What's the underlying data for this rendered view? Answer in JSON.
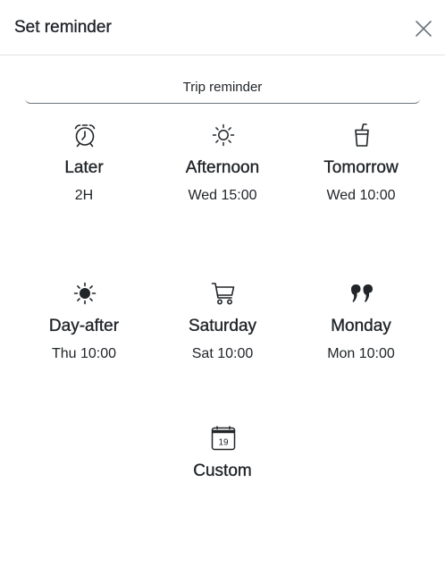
{
  "dialog": {
    "title": "Set reminder",
    "close_icon": "close-icon"
  },
  "input": {
    "value": "Trip reminder",
    "placeholder": ""
  },
  "options": [
    {
      "id": "later",
      "label": "Later",
      "time": "2H",
      "icon": "alarm-clock-icon"
    },
    {
      "id": "afternoon",
      "label": "Afternoon",
      "time": "Wed 15:00",
      "icon": "sun-outline-icon"
    },
    {
      "id": "tomorrow",
      "label": "Tomorrow",
      "time": "Wed 10:00",
      "icon": "cup-straw-icon"
    },
    {
      "id": "day-after",
      "label": "Day-after",
      "time": "Thu 10:00",
      "icon": "sun-fill-icon"
    },
    {
      "id": "saturday",
      "label": "Saturday",
      "time": "Sat 10:00",
      "icon": "cart-icon"
    },
    {
      "id": "monday",
      "label": "Monday",
      "time": "Mon 10:00",
      "icon": "quote-icon"
    },
    {
      "id": "custom",
      "label": "Custom",
      "time": "",
      "icon": "calendar-icon",
      "calendar_day": "19"
    }
  ],
  "colors": {
    "text": "#212529",
    "border": "#dee2e6",
    "input_border": "#6c757d"
  }
}
